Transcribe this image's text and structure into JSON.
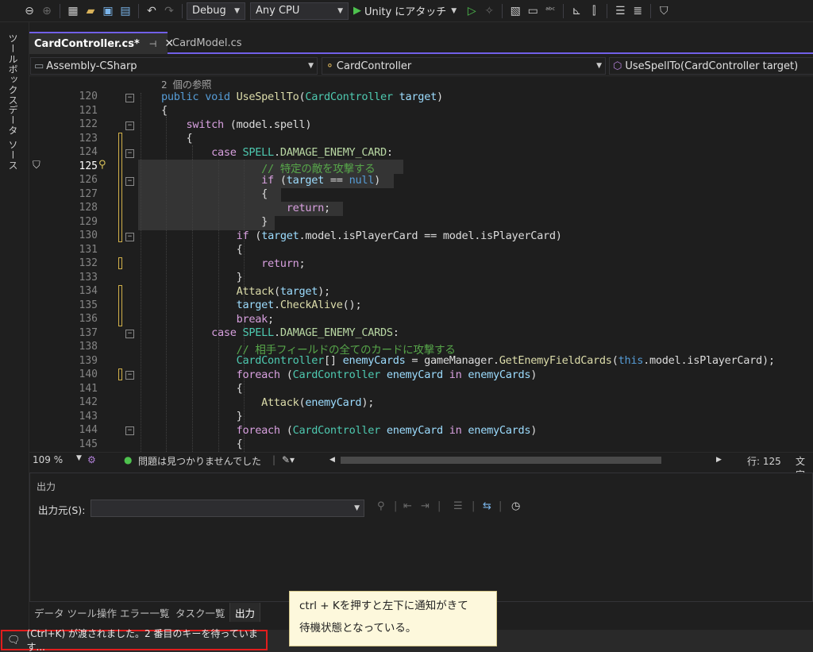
{
  "toolbar": {
    "config": "Debug",
    "platform": "Any CPU",
    "attach": "Unity にアタッチ"
  },
  "sidebar": {
    "toolbox": "ツールボックス",
    "datasource": "データ ソース"
  },
  "tabs": {
    "active": "CardController.cs*",
    "inactive": "CardModel.cs"
  },
  "navbar": {
    "project": "Assembly-CSharp",
    "type": "CardController",
    "member": "UseSpellTo(CardController target)"
  },
  "code": {
    "ref_count": "2 個の参照",
    "line_numbers": [
      "120",
      "121",
      "122",
      "123",
      "124",
      "125",
      "126",
      "127",
      "128",
      "129",
      "130",
      "131",
      "132",
      "133",
      "134",
      "135",
      "136",
      "137",
      "138",
      "139",
      "140",
      "141",
      "142",
      "143",
      "144",
      "145"
    ],
    "comment_125": "// 特定の敵を攻撃する",
    "comment_138": "// 相手フィールドの全てのカードに攻撃する"
  },
  "editor_status": {
    "zoom": "109 %",
    "issues": "問題は見つかりませんでした",
    "position": "行: 125",
    "chars": "文字"
  },
  "output": {
    "title": "出力",
    "source_label": "出力元(S):",
    "source_value": ""
  },
  "bottom_tabs": [
    "データ ツール操作",
    "エラー一覧",
    "タスク一覧",
    "出力"
  ],
  "status": {
    "notice": "(Ctrl+K) が渡されました。2 番目のキーを待っています..."
  },
  "callout": {
    "line1": "ctrl + Kを押すと左下に通知がきて",
    "line2": "待機状態となっている。"
  },
  "colors": {
    "accent": "#7160e8",
    "highlight_box": "#e21d1d",
    "callout_bg": "#fdf8dc"
  }
}
